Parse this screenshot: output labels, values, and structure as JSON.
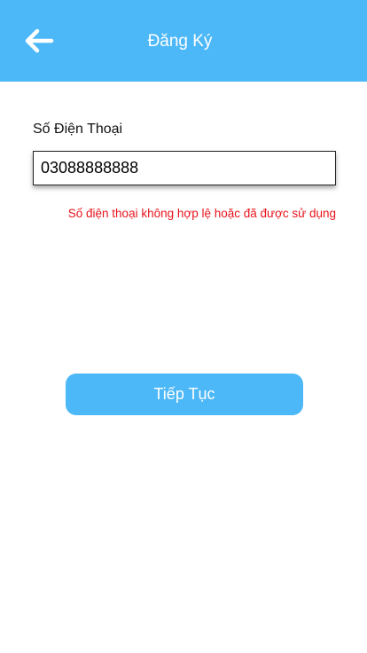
{
  "header": {
    "title": "Đăng Ký",
    "back_icon": "arrow-left-icon",
    "background_color": "#4db8f8"
  },
  "form": {
    "phone_label": "Số Điện Thoại",
    "phone_value": "03088888888",
    "error_message": "Số điện thoại không hợp lệ hoặc đã được sử dụng",
    "error_color": "#e8141c"
  },
  "actions": {
    "continue_label": "Tiếp Tục",
    "continue_color": "#4db8f8"
  }
}
